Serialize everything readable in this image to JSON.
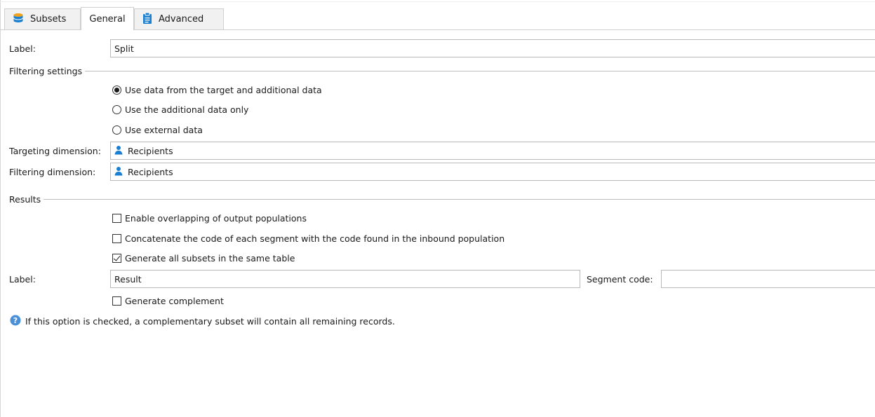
{
  "tabs": [
    {
      "label": "Subsets",
      "icon": "database-icon",
      "active": false
    },
    {
      "label": "General",
      "icon": "",
      "active": true
    },
    {
      "label": "Advanced",
      "icon": "clipboard-icon",
      "active": false
    }
  ],
  "general": {
    "label_caption": "Label:",
    "label_value": "Split",
    "filtering_section": "Filtering settings",
    "filter_options": [
      {
        "label": "Use data from the target and additional data",
        "selected": true
      },
      {
        "label": "Use the additional data only",
        "selected": false
      },
      {
        "label": "Use external data",
        "selected": false
      }
    ],
    "targeting_caption": "Targeting dimension:",
    "targeting_value": "Recipients",
    "filtering_dim_caption": "Filtering dimension:",
    "filtering_dim_value": "Recipients"
  },
  "results": {
    "section": "Results",
    "options": [
      {
        "label": "Enable overlapping of output populations",
        "checked": false
      },
      {
        "label": "Concatenate the code of each segment with the code found in the inbound population",
        "checked": false
      },
      {
        "label": "Generate all subsets in the same table",
        "checked": true
      }
    ],
    "label_caption": "Label:",
    "label_value": "Result",
    "segment_caption": "Segment code:",
    "segment_value": "",
    "complement_label": "Generate complement",
    "complement_checked": false,
    "info_text": "If this option is checked, a complementary subset will contain all remaining records."
  },
  "colors": {
    "accent": "#1a7fd0",
    "db_icon": "#f0a21c",
    "info_icon": "#4a90d9"
  }
}
